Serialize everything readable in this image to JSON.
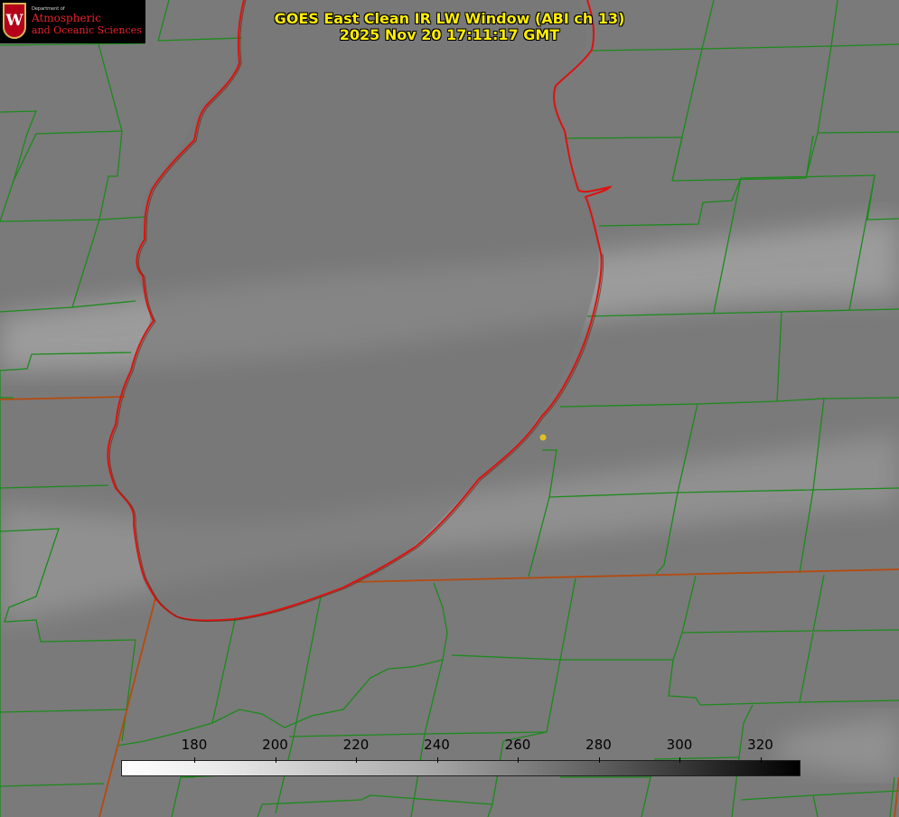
{
  "title": {
    "line1": "GOES East Clean IR LW Window (ABI ch 13)",
    "line2": "2025 Nov 20 17:11:17 GMT"
  },
  "logo": {
    "department": "Department of",
    "line1": "Atmospheric",
    "line2": "and Oceanic Sciences",
    "seal_letter": "W"
  },
  "colorbar": {
    "ticks": [
      "180",
      "200",
      "220",
      "240",
      "260",
      "280",
      "300",
      "320"
    ],
    "gradient": [
      "#ffffff",
      "#000000"
    ]
  },
  "map": {
    "background_gray": "#7a7a7a",
    "county_line_color": "#1c8a1c",
    "coast_line_color": "#e01010",
    "state_line_color": "#b54a10",
    "marker_color": "#e0c020"
  }
}
